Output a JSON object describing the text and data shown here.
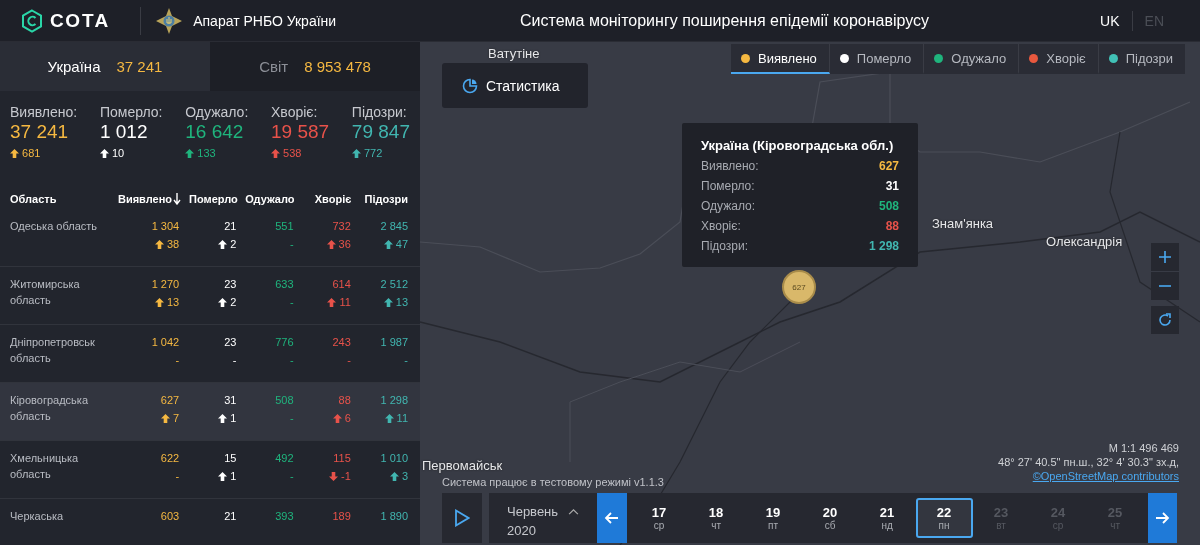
{
  "header": {
    "logo_text": "СОТА",
    "org": "Апарат РНБО України",
    "title": "Система моніторингу поширення епідемії коронавірусу",
    "languages": [
      {
        "label": "UK",
        "selected": true
      },
      {
        "label": "EN",
        "selected": false
      }
    ]
  },
  "scope_tabs": [
    {
      "label": "Україна",
      "value": "37 241",
      "selected": true
    },
    {
      "label": "Світ",
      "value": "8 953 478",
      "selected": false
    }
  ],
  "summary": [
    {
      "kind": "detected",
      "label": "Виявлено:",
      "value": "37 241",
      "delta": "681"
    },
    {
      "kind": "died",
      "label": "Померло:",
      "value": "1 012",
      "delta": "10"
    },
    {
      "kind": "recovered",
      "label": "Одужало:",
      "value": "16 642",
      "delta": "133"
    },
    {
      "kind": "sick",
      "label": "Хворіє:",
      "value": "19 587",
      "delta": "538"
    },
    {
      "kind": "suspected",
      "label": "Підозри:",
      "value": "79 847",
      "delta": "772"
    }
  ],
  "table": {
    "columns": [
      {
        "label": "Область",
        "sorted": false
      },
      {
        "label": "Виявлено",
        "sorted": true
      },
      {
        "label": "Померло",
        "sorted": false
      },
      {
        "label": "Одужало",
        "sorted": false
      },
      {
        "label": "Хворіє",
        "sorted": false
      },
      {
        "label": "Підозри",
        "sorted": false
      }
    ],
    "rows": [
      {
        "selected": false,
        "cells": [
          {
            "value": "Одеська область"
          },
          {
            "value": "1 304",
            "delta": "38",
            "rising": true
          },
          {
            "value": "21",
            "delta": "2",
            "rising": true
          },
          {
            "value": "551",
            "delta": "-"
          },
          {
            "value": "732",
            "delta": "36",
            "rising": true
          },
          {
            "value": "2 845",
            "delta": "47",
            "rising": true
          }
        ]
      },
      {
        "selected": false,
        "cells": [
          {
            "value": "Житомирська область"
          },
          {
            "value": "1 270",
            "delta": "13",
            "rising": true
          },
          {
            "value": "23",
            "delta": "2",
            "rising": true
          },
          {
            "value": "633",
            "delta": "-"
          },
          {
            "value": "614",
            "delta": "11",
            "rising": true
          },
          {
            "value": "2 512",
            "delta": "13",
            "rising": true
          }
        ]
      },
      {
        "selected": false,
        "cells": [
          {
            "value": "Дніпропетровськ область"
          },
          {
            "value": "1 042",
            "delta": "-"
          },
          {
            "value": "23",
            "delta": "-"
          },
          {
            "value": "776",
            "delta": "-"
          },
          {
            "value": "243",
            "delta": "-"
          },
          {
            "value": "1 987",
            "delta": "-"
          }
        ]
      },
      {
        "selected": true,
        "cells": [
          {
            "value": "Кіровоградська область"
          },
          {
            "value": "627",
            "delta": "7",
            "rising": true
          },
          {
            "value": "31",
            "delta": "1",
            "rising": true
          },
          {
            "value": "508",
            "delta": "-"
          },
          {
            "value": "88",
            "delta": "6",
            "rising": true
          },
          {
            "value": "1 298",
            "delta": "11",
            "rising": true
          }
        ]
      },
      {
        "selected": false,
        "cells": [
          {
            "value": "Хмельницька область"
          },
          {
            "value": "622",
            "delta": "-"
          },
          {
            "value": "15",
            "delta": "1",
            "rising": true
          },
          {
            "value": "492",
            "delta": "-"
          },
          {
            "value": "115",
            "delta": "-1",
            "rising": false
          },
          {
            "value": "1 010",
            "delta": "3",
            "rising": true
          }
        ]
      },
      {
        "selected": false,
        "cells": [
          {
            "value": "Черкаська"
          },
          {
            "value": "603"
          },
          {
            "value": "21"
          },
          {
            "value": "393"
          },
          {
            "value": "189"
          },
          {
            "value": "1 890"
          }
        ]
      }
    ]
  },
  "map": {
    "stats_button": "Статистика",
    "legend": [
      {
        "label": "Виявлено",
        "color": "#f5b841",
        "selected": true
      },
      {
        "label": "Померло",
        "color": "#ffffff",
        "selected": false
      },
      {
        "label": "Одужало",
        "color": "#1fb47d",
        "selected": false
      },
      {
        "label": "Хворіє",
        "color": "#e8583e",
        "selected": false
      },
      {
        "label": "Підозри",
        "color": "#41c1b6",
        "selected": false
      }
    ],
    "places": [
      {
        "name": "Ватутіне"
      },
      {
        "name": "Знам'янка"
      },
      {
        "name": "Олександрія"
      },
      {
        "name": "Первомайськ"
      }
    ],
    "marker": "627",
    "tooltip": {
      "title": "Україна (Кіровоградська обл.)",
      "rows": [
        {
          "kind": "detected",
          "label": "Виявлено:",
          "value": "627"
        },
        {
          "kind": "died",
          "label": "Померло:",
          "value": "31"
        },
        {
          "kind": "recovered",
          "label": "Одужало:",
          "value": "508"
        },
        {
          "kind": "sick",
          "label": "Хворіє:",
          "value": "88"
        },
        {
          "kind": "suspected",
          "label": "Підозри:",
          "value": "1 298"
        }
      ]
    },
    "scale": "M 1:1 496 469",
    "coords": "48° 27' 40.5\" пн.ш., 32° 4' 30.3\" зх.д,",
    "attribution": "©OpenStreetMap contributors",
    "notice": "Система працює в тестовому режимі v1.1.3"
  },
  "timeline": {
    "month": "Червень",
    "year": "2020",
    "days": [
      {
        "day": "17",
        "weekday": "ср",
        "selected": false,
        "disabled": false
      },
      {
        "day": "18",
        "weekday": "чт",
        "selected": false,
        "disabled": false
      },
      {
        "day": "19",
        "weekday": "пт",
        "selected": false,
        "disabled": false
      },
      {
        "day": "20",
        "weekday": "сб",
        "selected": false,
        "disabled": false
      },
      {
        "day": "21",
        "weekday": "нд",
        "selected": false,
        "disabled": false
      },
      {
        "day": "22",
        "weekday": "пн",
        "selected": true,
        "disabled": false
      },
      {
        "day": "23",
        "weekday": "вт",
        "selected": false,
        "disabled": true
      },
      {
        "day": "24",
        "weekday": "ср",
        "selected": false,
        "disabled": true
      },
      {
        "day": "25",
        "weekday": "чт",
        "selected": false,
        "disabled": true
      }
    ]
  }
}
